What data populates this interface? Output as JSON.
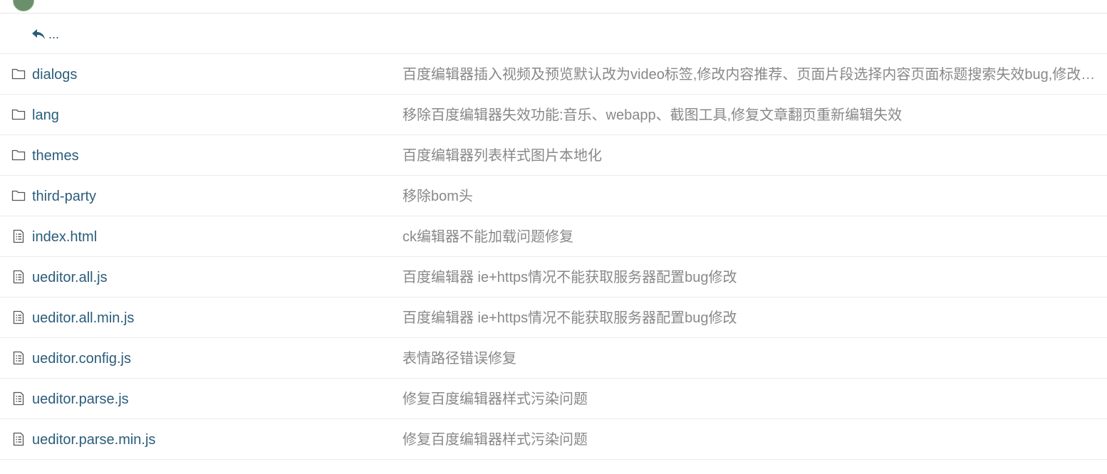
{
  "back": {
    "label": "..."
  },
  "entries": [
    {
      "type": "folder",
      "name": "dialogs",
      "message": "百度编辑器插入视频及预览默认改为video标签,修改内容推荐、页面片段选择内容页面标题搜索失效bug,修改内容页面标题搜索失效bug"
    },
    {
      "type": "folder",
      "name": "lang",
      "message": "移除百度编辑器失效功能:音乐、webapp、截图工具,修复文章翻页重新编辑失效"
    },
    {
      "type": "folder",
      "name": "themes",
      "message": "百度编辑器列表样式图片本地化"
    },
    {
      "type": "folder",
      "name": "third-party",
      "message": "移除bom头"
    },
    {
      "type": "file",
      "name": "index.html",
      "message": "ck编辑器不能加载问题修复"
    },
    {
      "type": "file",
      "name": "ueditor.all.js",
      "message": "百度编辑器 ie+https情况不能获取服务器配置bug修改"
    },
    {
      "type": "file",
      "name": "ueditor.all.min.js",
      "message": "百度编辑器 ie+https情况不能获取服务器配置bug修改"
    },
    {
      "type": "file",
      "name": "ueditor.config.js",
      "message": "表情路径错误修复"
    },
    {
      "type": "file",
      "name": "ueditor.parse.js",
      "message": "修复百度编辑器样式污染问题"
    },
    {
      "type": "file",
      "name": "ueditor.parse.min.js",
      "message": "修复百度编辑器样式污染问题"
    }
  ]
}
